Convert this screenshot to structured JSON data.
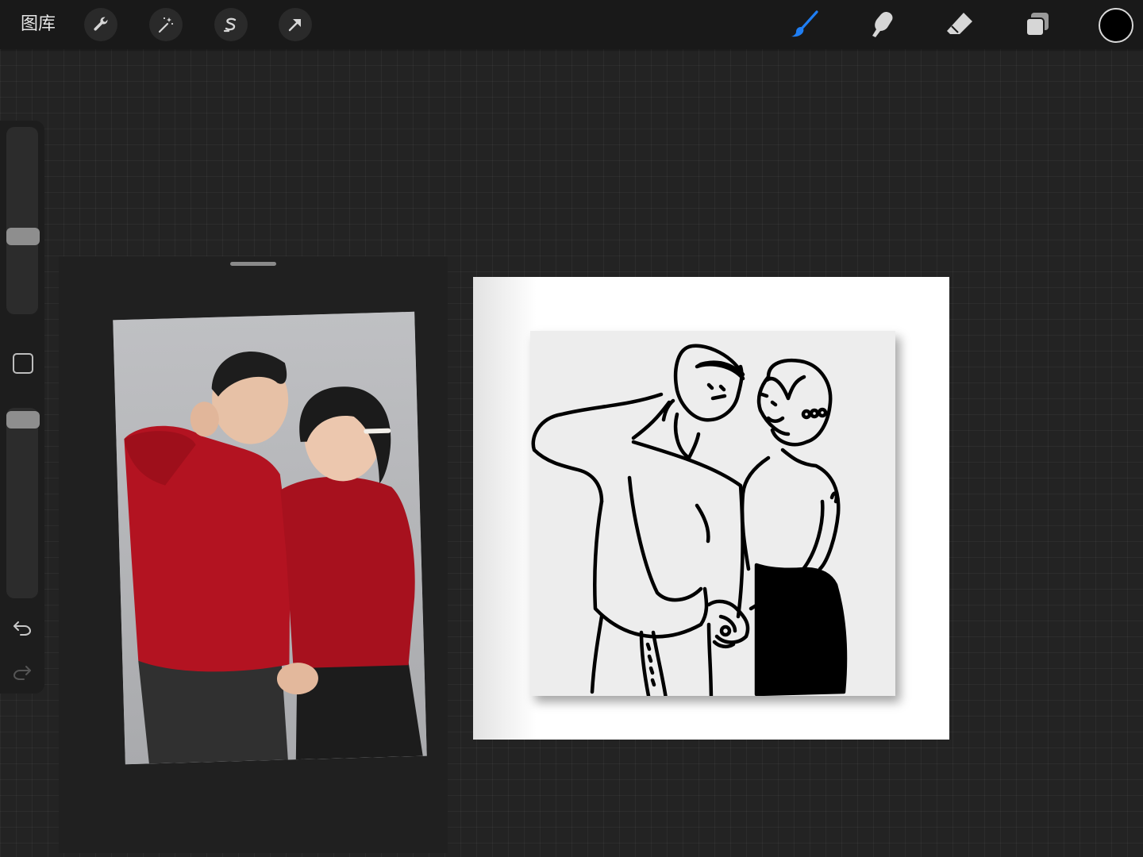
{
  "toolbar": {
    "gallery_label": "图库",
    "left_tools": [
      {
        "name": "actions",
        "icon": "wrench-icon"
      },
      {
        "name": "adjustments",
        "icon": "magic-wand-icon"
      },
      {
        "name": "selection",
        "icon": "selection-s-icon"
      },
      {
        "name": "transform",
        "icon": "arrow-cursor-icon"
      }
    ],
    "right_tools": [
      {
        "name": "brush",
        "icon": "brush-icon",
        "active": true
      },
      {
        "name": "smudge",
        "icon": "smudge-icon",
        "active": false
      },
      {
        "name": "eraser",
        "icon": "eraser-icon",
        "active": false
      },
      {
        "name": "layers",
        "icon": "layers-icon",
        "active": false
      }
    ],
    "current_color": "#000000",
    "active_color": "#1f7ef3"
  },
  "sidebar": {
    "brush_size_level": 0.58,
    "opacity_level": 0.12,
    "modify_button": "square-icon",
    "undo": "undo-icon",
    "redo": "redo-icon"
  },
  "reference": {
    "photo": "couple-in-red-sweaters-photo"
  },
  "canvas": {
    "artwork": "line-art-couple-illustration",
    "paper_color": "#ffffff",
    "card_color": "#ededed"
  }
}
